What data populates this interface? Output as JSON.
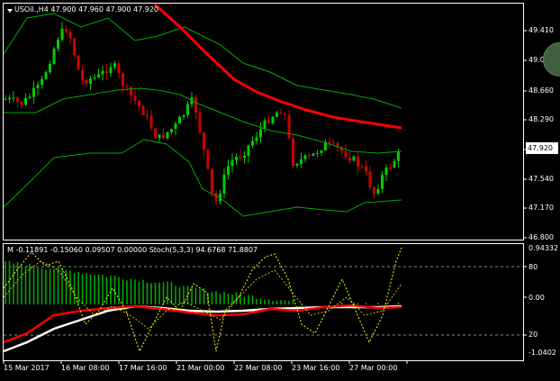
{
  "main": {
    "header": "USOil.,H4  47.900 47.960 47.900 47.920",
    "price_labels": [
      "49.410",
      "49.040",
      "48.660",
      "48.290",
      "47.540",
      "47.170",
      "46.800"
    ],
    "current_price": "47.920"
  },
  "sub": {
    "header": "M -0.11891 -0.15060 0.09507 0.00000   Stoch(5,3,3) 94.6768 71.8807",
    "labels": [
      "0.94332",
      "80",
      "0.00",
      "20",
      "-1.0402"
    ]
  },
  "x_axis": {
    "labels": [
      "15 Mar 2017",
      "16 Mar 08:00",
      "17 Mar 16:00",
      "21 Mar 00:00",
      "22 Mar 08:00",
      "23 Mar 16:00",
      "27 Mar 00:00"
    ]
  },
  "colors": {
    "background": "#000000",
    "grid": "#ffffff",
    "bull": "#00cc00",
    "bear": "#cc0000",
    "ma": "#ff0000",
    "bands": "#00aa00",
    "stoch_main": "#ffff00",
    "stoch_signal": "#c8c800",
    "macd_hist": "#00b000",
    "macd_main": "#ffffff",
    "macd_signal": "#ff0000"
  }
}
